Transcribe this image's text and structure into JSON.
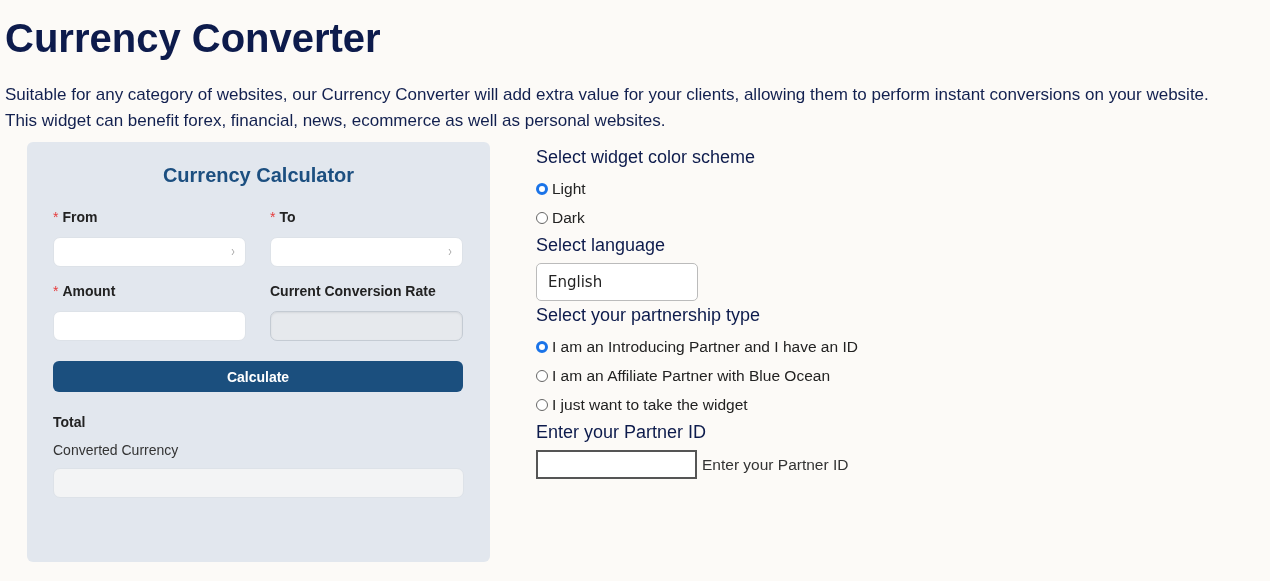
{
  "title": "Currency Converter",
  "description": [
    "Suitable for any category of websites, our Currency Converter will add extra value for your clients, allowing them to perform instant conversions on your website.",
    "This widget can benefit forex, financial, news, ecommerce as well as personal websites."
  ],
  "calculator": {
    "title": "Currency Calculator",
    "fields": [
      {
        "label": "From",
        "required_mark": "*",
        "kind": "select",
        "disabled": false
      },
      {
        "label": "To",
        "required_mark": "*",
        "kind": "select",
        "disabled": false
      },
      {
        "label": "Amount",
        "required_mark": "*",
        "kind": "input",
        "disabled": false
      },
      {
        "label": "Current Conversion Rate",
        "kind": "input",
        "disabled": true
      }
    ],
    "button": "Calculate",
    "total_label": "Total",
    "result_label": "Converted Currency"
  },
  "settings": [
    {
      "kind": "radio",
      "heading": "Select widget color scheme",
      "options": [
        {
          "label": "Light",
          "selected": true
        },
        {
          "label": "Dark",
          "selected": false
        }
      ]
    },
    {
      "kind": "select",
      "heading": "Select language",
      "value": "English"
    },
    {
      "kind": "radio",
      "heading": "Select your partnership type",
      "options": [
        {
          "label": "I am an Introducing Partner and I have an ID",
          "selected": true
        },
        {
          "label": "I am an Affiliate Partner with Blue Ocean",
          "selected": false
        },
        {
          "label": "I just want to take the widget",
          "selected": false
        }
      ]
    },
    {
      "kind": "text",
      "heading": "Enter your Partner ID",
      "hint": "Enter your Partner ID"
    }
  ]
}
